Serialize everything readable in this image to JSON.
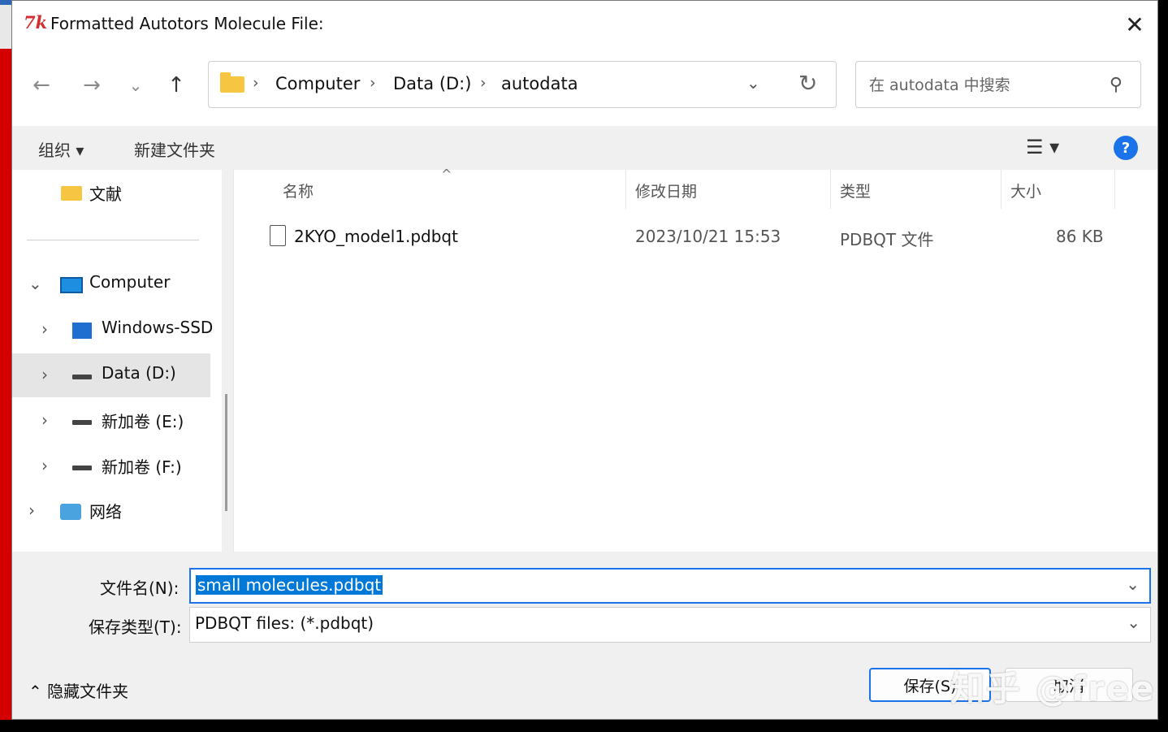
{
  "window": {
    "logo": "7k",
    "title": "Formatted Autotors Molecule File:"
  },
  "nav": {
    "breadcrumbs": [
      "Computer",
      "Data (D:)",
      "autodata"
    ],
    "search_placeholder": "在 autodata 中搜索"
  },
  "commands": {
    "organize": "组织 ▾",
    "new_folder": "新建文件夹"
  },
  "sidebar": {
    "items": [
      {
        "label": "文献"
      },
      {
        "label": "Computer"
      },
      {
        "label": "Windows-SSD"
      },
      {
        "label": "Data (D:)"
      },
      {
        "label": "新加卷 (E:)"
      },
      {
        "label": "新加卷 (F:)"
      },
      {
        "label": "网络"
      }
    ]
  },
  "filelist": {
    "columns": [
      "名称",
      "修改日期",
      "类型",
      "大小"
    ],
    "rows": [
      {
        "name": "2KYO_model1.pdbqt",
        "date": "2023/10/21 15:53",
        "type": "PDBQT 文件",
        "size": "86 KB"
      }
    ]
  },
  "bottom": {
    "filename_label": "文件名(N):",
    "filename_value": "small molecules.pdbqt",
    "filetype_label": "保存类型(T):",
    "filetype_value": "PDBQT files: (*.pdbqt)",
    "hide_folders": "隐藏文件夹",
    "save_label": "保存(S)",
    "cancel_label": "取消"
  },
  "watermark": "知乎 @free",
  "colors": {
    "accent": "#1a73e8",
    "selection": "#0078d7",
    "folder": "#f6c541"
  }
}
